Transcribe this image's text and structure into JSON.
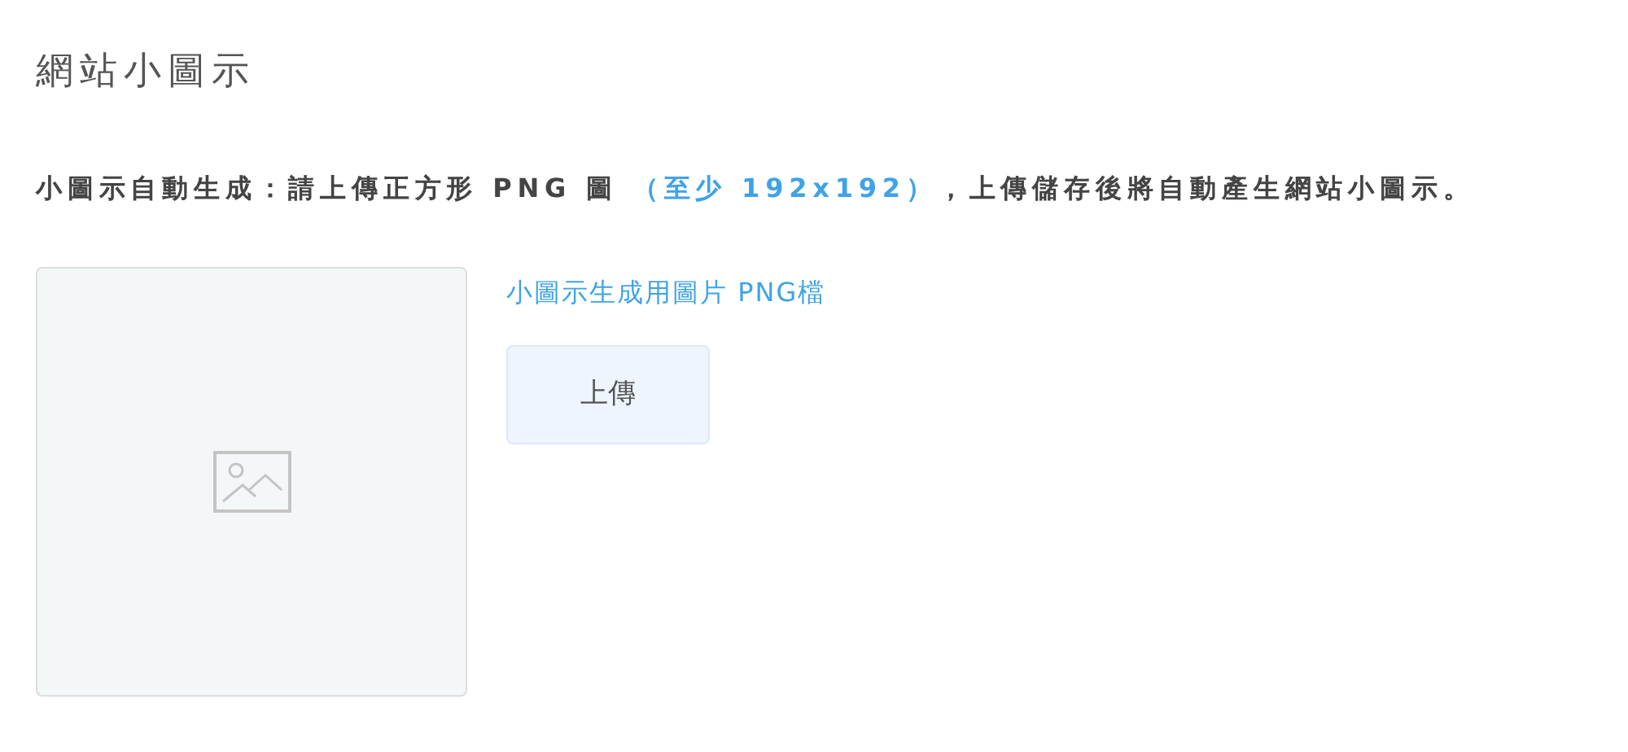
{
  "title": "網站小圖示",
  "description": [
    {
      "text": "小圖示自動生成：請上傳正方形 PNG 圖 ",
      "highlight": false
    },
    {
      "text": "（至少 192x192）",
      "highlight": true
    },
    {
      "text": "，上傳儲存後將自動產生網站小圖示。",
      "highlight": false
    }
  ],
  "preview": {
    "kind": "placeholder"
  },
  "file_label": "小圖示生成用圖片 PNG檔",
  "upload_button": "上傳"
}
